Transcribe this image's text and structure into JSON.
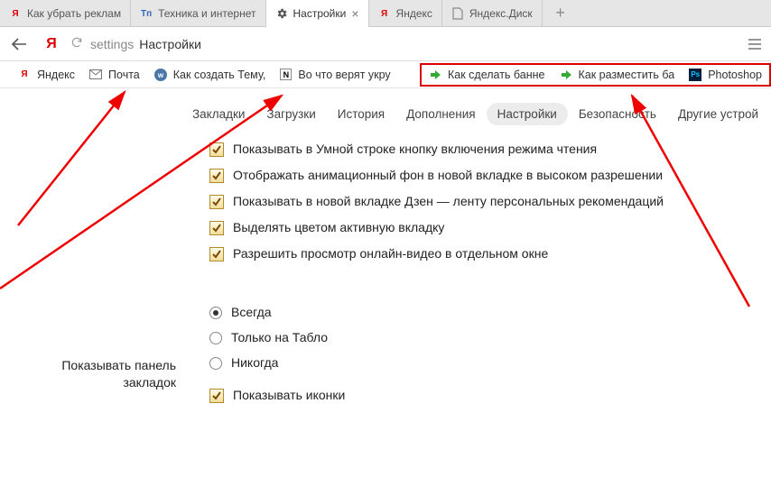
{
  "tabs": [
    {
      "label": "Как убрать реклам"
    },
    {
      "label": "Техника и интернет"
    },
    {
      "label": "Настройки"
    },
    {
      "label": "Яндекс"
    },
    {
      "label": "Яндекс.Диск"
    }
  ],
  "address": {
    "path": "settings",
    "title": "Настройки"
  },
  "bookmarks": [
    {
      "label": "Яндекс"
    },
    {
      "label": "Почта"
    },
    {
      "label": "Как создать Тему,"
    },
    {
      "label": "Во что верят укру"
    }
  ],
  "bookmarks_hl": [
    {
      "label": "Как сделать банне"
    },
    {
      "label": "Как разместить ба"
    },
    {
      "label": "Photoshop"
    }
  ],
  "subnav": [
    "Закладки",
    "Загрузки",
    "История",
    "Дополнения",
    "Настройки",
    "Безопасность",
    "Другие устрой"
  ],
  "options": [
    "Показывать в Умной строке кнопку включения режима чтения",
    "Отображать анимационный фон в новой вкладке в высоком разрешении",
    "Показывать в новой вкладке Дзен — ленту персональных рекомендаций",
    "Выделять цветом активную вкладку",
    "Разрешить просмотр онлайн-видео в отдельном окне"
  ],
  "section": {
    "label": "Показывать панель закладок"
  },
  "radios": [
    "Всегда",
    "Только на Табло",
    "Никогда"
  ],
  "show_icons": "Показывать иконки"
}
